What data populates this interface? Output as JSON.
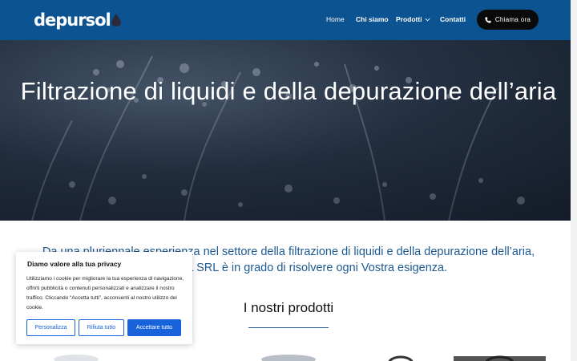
{
  "header": {
    "logo_text": "depursol",
    "nav": {
      "home": "Home",
      "chi_siamo": "Chi siamo",
      "prodotti": "Prodotti",
      "contatti": "Contatti"
    },
    "call_button": "Chiama ora",
    "brand_color": "#0c5391"
  },
  "hero": {
    "title": "Filtrazione di liquidi e della depurazione dell’aria"
  },
  "intro": {
    "line1": "Da una pluriennale esperienza nel settore della filtrazione di liquidi e della depurazione dell’aria,",
    "line2": "DEPURSOL SRL è in grado di risolvere ogni Vostra esigenza."
  },
  "products": {
    "title": "I nostri prodotti"
  },
  "cookie": {
    "title": "Diamo valore alla tua privacy",
    "text": "Utilizziamo i cookie per migliorare la tua esperienza di navigazione, offrirti pubblicità o contenuti personalizzati e analizzare il nostro traffico. Cliccando “Accetta tutti”, acconsenti al nostro utilizzo dei cookie.",
    "buttons": {
      "customize": "Personalizza",
      "reject": "Rifiuta tutto",
      "accept": "Accettare tutto"
    },
    "accent_color": "#1863dc"
  }
}
